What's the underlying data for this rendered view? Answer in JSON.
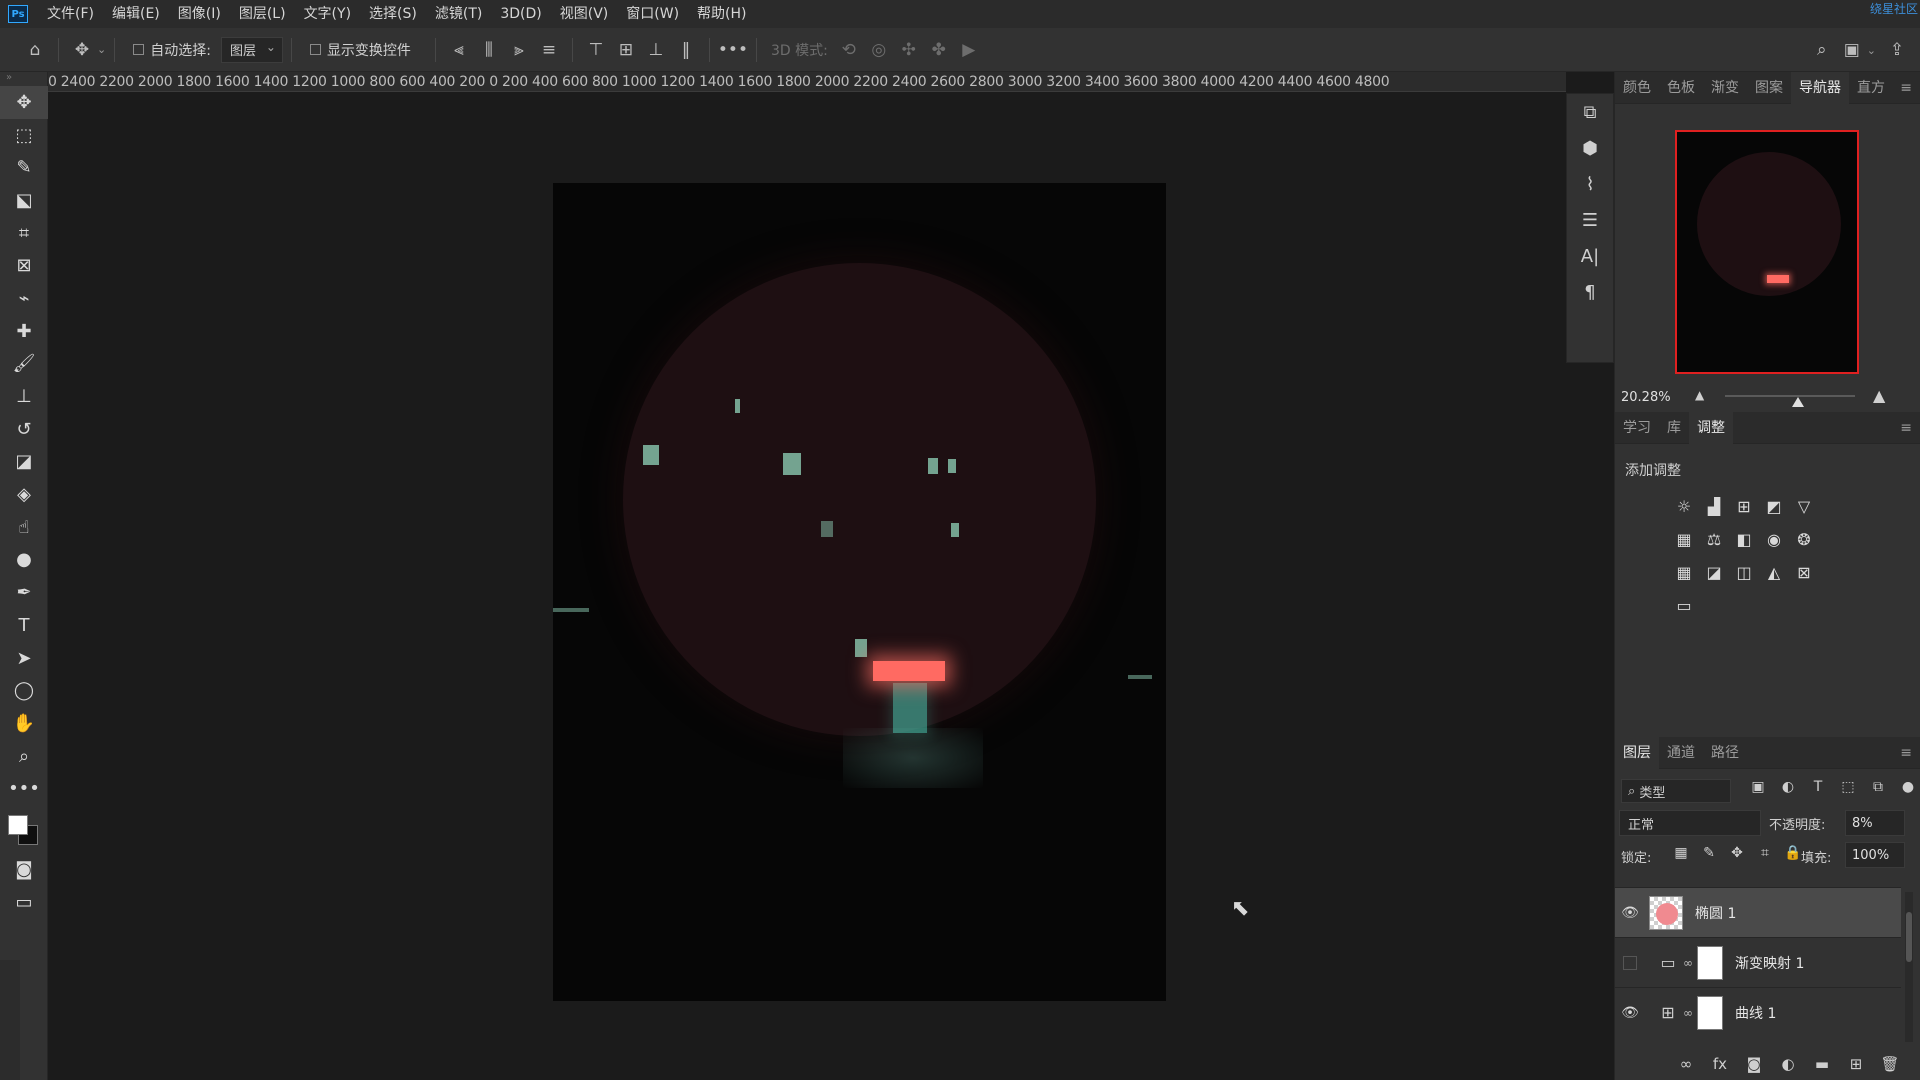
{
  "app": {
    "logo": "Ps",
    "watermark": "绕星社区"
  },
  "menu": [
    "文件(F)",
    "编辑(E)",
    "图像(I)",
    "图层(L)",
    "文字(Y)",
    "选择(S)",
    "滤镜(T)",
    "3D(D)",
    "视图(V)",
    "窗口(W)",
    "帮助(H)"
  ],
  "options_bar": {
    "auto_select_label": "自动选择:",
    "auto_select_target": "图层",
    "show_transform_label": "显示变换控件",
    "more": "•••",
    "mode_3d_label": "3D 模式:"
  },
  "ruler": {
    "top_labels": "0 2400 2200 2000 1800 1600 1400 1200 1000 800 600 400 200 0 200 400 600 800 1000 1200 1400 1600 1800 2000 2200 2400 2600 2800 3000 3200 3400 3600 3800 4000 4200 4400 4600 4800"
  },
  "navigator_panel": {
    "tabs": [
      "颜色",
      "色板",
      "渐变",
      "图案",
      "导航器",
      "直方"
    ],
    "active_tab": "导航器",
    "zoom": "20.28%",
    "zoom_fraction": 0.56
  },
  "adjustments_panel": {
    "tabs": [
      "学习",
      "库",
      "调整"
    ],
    "active_tab": "调整",
    "title": "添加调整",
    "icons": [
      "brightness-icon",
      "levels-icon",
      "curves-icon",
      "exposure-icon",
      "vibrance-icon",
      "hue-saturation-icon",
      "color-balance-icon",
      "black-white-icon",
      "photo-filter-icon",
      "channel-mixer-icon",
      "color-lookup-icon",
      "invert-icon",
      "posterize-icon",
      "threshold-icon",
      "selective-color-icon",
      "gradient-map-icon"
    ]
  },
  "layers_panel": {
    "tabs": [
      "图层",
      "通道",
      "路径"
    ],
    "active_tab": "图层",
    "kind_filter": "类型",
    "blend_mode": "正常",
    "opacity_label": "不透明度:",
    "opacity_value": "8%",
    "lock_label": "锁定:",
    "fill_label": "填充:",
    "fill_value": "100%",
    "layers": [
      {
        "name": "椭圆 1",
        "visible": true,
        "selected": true
      },
      {
        "name": "渐变映射 1",
        "visible": false,
        "selected": false
      },
      {
        "name": "曲线 1",
        "visible": true,
        "selected": false
      }
    ]
  },
  "colors": {
    "accent_red": "#e02020",
    "store_light": "#ff6a62",
    "circle_fill": "#1e0f12"
  }
}
